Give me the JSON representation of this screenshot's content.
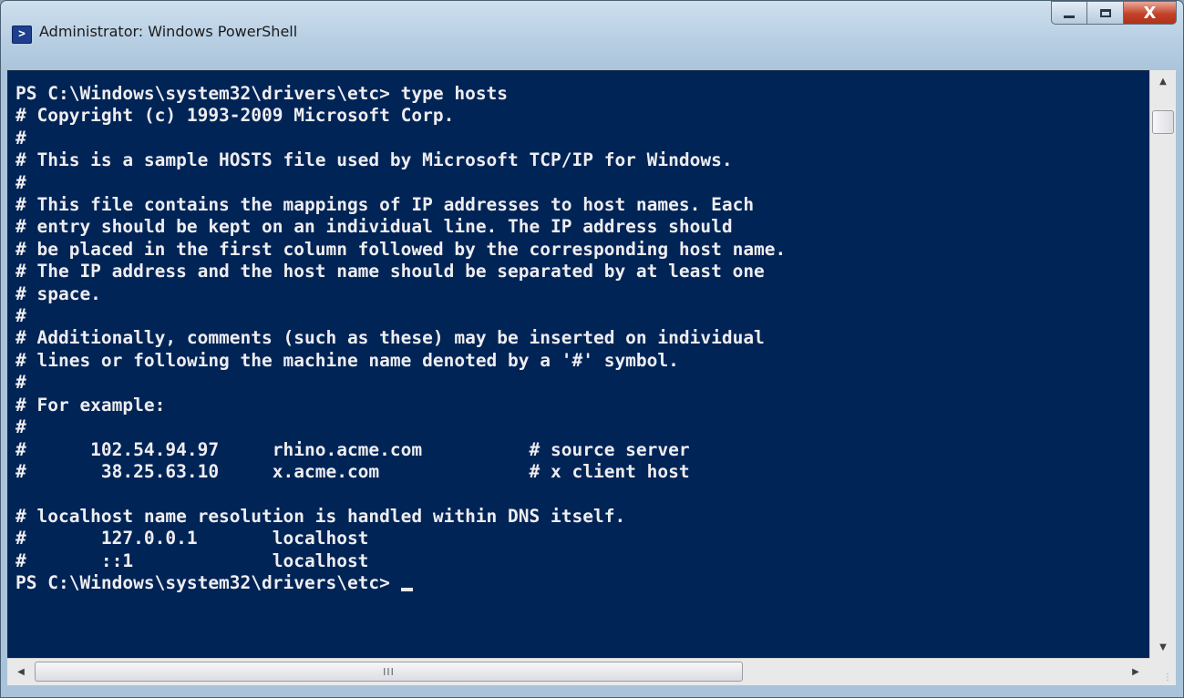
{
  "window": {
    "title": "Administrator: Windows PowerShell",
    "icon": "powershell-icon",
    "buttons": {
      "minimize": "minimize-icon",
      "maximize": "maximize-icon",
      "close": "close-icon",
      "close_glyph": "X"
    }
  },
  "console": {
    "background": "#012456",
    "foreground": "#eeedf0",
    "lines": [
      "PS C:\\Windows\\system32\\drivers\\etc> type hosts",
      "# Copyright (c) 1993-2009 Microsoft Corp.",
      "#",
      "# This is a sample HOSTS file used by Microsoft TCP/IP for Windows.",
      "#",
      "# This file contains the mappings of IP addresses to host names. Each",
      "# entry should be kept on an individual line. The IP address should",
      "# be placed in the first column followed by the corresponding host name.",
      "# The IP address and the host name should be separated by at least one",
      "# space.",
      "#",
      "# Additionally, comments (such as these) may be inserted on individual",
      "# lines or following the machine name denoted by a '#' symbol.",
      "#",
      "# For example:",
      "#",
      "#      102.54.94.97     rhino.acme.com          # source server",
      "#       38.25.63.10     x.acme.com              # x client host",
      "",
      "# localhost name resolution is handled within DNS itself.",
      "#\t127.0.0.1       localhost",
      "#\t::1             localhost"
    ],
    "prompt": "PS C:\\Windows\\system32\\drivers\\etc> "
  },
  "scrollbars": {
    "grip_glyph": "III"
  }
}
